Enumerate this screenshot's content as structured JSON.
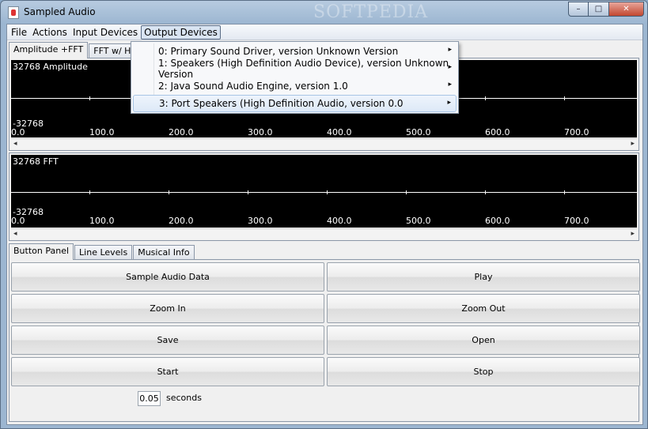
{
  "window": {
    "title": "Sampled Audio",
    "watermark": "SOFTPEDIA",
    "controls": {
      "minimize": "–",
      "maximize": "□",
      "close": "✕"
    }
  },
  "menubar": {
    "items": [
      "File",
      "Actions",
      "Input Devices",
      "Output Devices"
    ]
  },
  "top_tabs": [
    "Amplitude +FFT",
    "FFT w/ Histor"
  ],
  "amplitude_plot": {
    "max_label": "32768  Amplitude",
    "min_label": "-32768",
    "x_ticks": [
      "0.0",
      "100.0",
      "200.0",
      "300.0",
      "400.0",
      "500.0",
      "600.0",
      "700.0"
    ]
  },
  "fft_plot": {
    "max_label": "32768  FFT",
    "min_label": "-32768",
    "x_ticks": [
      "0.0",
      "100.0",
      "200.0",
      "300.0",
      "400.0",
      "500.0",
      "600.0",
      "700.0"
    ]
  },
  "scroll": {
    "left": "◂",
    "right": "▸"
  },
  "bottom_tabs": [
    "Button Panel",
    "Line Levels",
    "Musical Info"
  ],
  "buttons": {
    "sample": "Sample Audio Data",
    "play": "Play",
    "zoom_in": "Zoom In",
    "zoom_out": "Zoom Out",
    "save": "Save",
    "open": "Open",
    "start": "Start",
    "stop": "Stop"
  },
  "seconds": {
    "value": "0.05",
    "label": "seconds"
  },
  "output_devices_menu": [
    "0: Primary Sound Driver, version Unknown Version",
    "1: Speakers (High Definition Audio Device), version Unknown Version",
    "2: Java Sound Audio Engine, version 1.0",
    "3: Port Speakers (High Definition Audio, version 0.0"
  ],
  "submenu_arrow": "▸"
}
